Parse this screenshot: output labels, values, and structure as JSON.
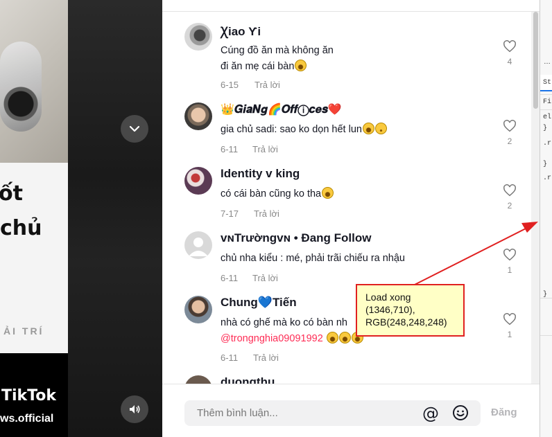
{
  "video": {
    "caption_line1": "ốt",
    "caption_line2": "chủ",
    "caption_line3": "ẢI TRÍ",
    "watermark_logo": "TikTok",
    "watermark_handle": "ws.official"
  },
  "comments": [
    {
      "name": "Ꭓiao Ƴi",
      "text_lines": [
        "Cúng đồ ăn mà không ăn",
        "đi ăn mẹ cái bàn"
      ],
      "date": "6-15",
      "reply": "Trả lời",
      "likes": "4"
    },
    {
      "name": "👑𝑮𝒊𝒂𝑵𝒈🌈𝑶𝒇𝒇ⓘ𝒄𝒆𝒔❤️",
      "text_lines": [
        "gia chủ sadi: sao ko dọn hết lun"
      ],
      "date": "6-11",
      "reply": "Trả lời",
      "likes": "2"
    },
    {
      "name": "Identity v king",
      "text_lines": [
        "có cái bàn cũng ko tha"
      ],
      "date": "7-17",
      "reply": "Trả lời",
      "likes": "2"
    },
    {
      "name": "ᴠɴTrườngᴠɴ • Đang Follow",
      "text_lines": [
        "chủ nha kiểu : mé, phải trãi chiếu ra nhậu"
      ],
      "date": "6-11",
      "reply": "Trả lời",
      "likes": "1"
    },
    {
      "name": "Chung💙Tiến",
      "text_lines": [
        "nhà có ghế mà ko có bàn nh"
      ],
      "mention": "@trongnghia09091992",
      "date": "6-11",
      "reply": "Trả lời",
      "likes": "1"
    },
    {
      "name": "duongthu",
      "text_lines": [],
      "date": "",
      "reply": "",
      "likes": ""
    }
  ],
  "input": {
    "placeholder": "Thêm bình luận...",
    "post_label": "Đăng"
  },
  "devtools": {
    "tab_label": "St",
    "filter_label": "Fi",
    "lines": [
      "el",
      "}",
      ".r",
      "}",
      ".r",
      "}"
    ]
  },
  "annotation": {
    "line1": "Load xong",
    "line2": "(1346,710),",
    "line3": "RGB(248,248,248)"
  },
  "colors": {
    "mention": "#fe2c55",
    "annotation_border": "#e02020",
    "annotation_bg": "#ffffc6"
  }
}
